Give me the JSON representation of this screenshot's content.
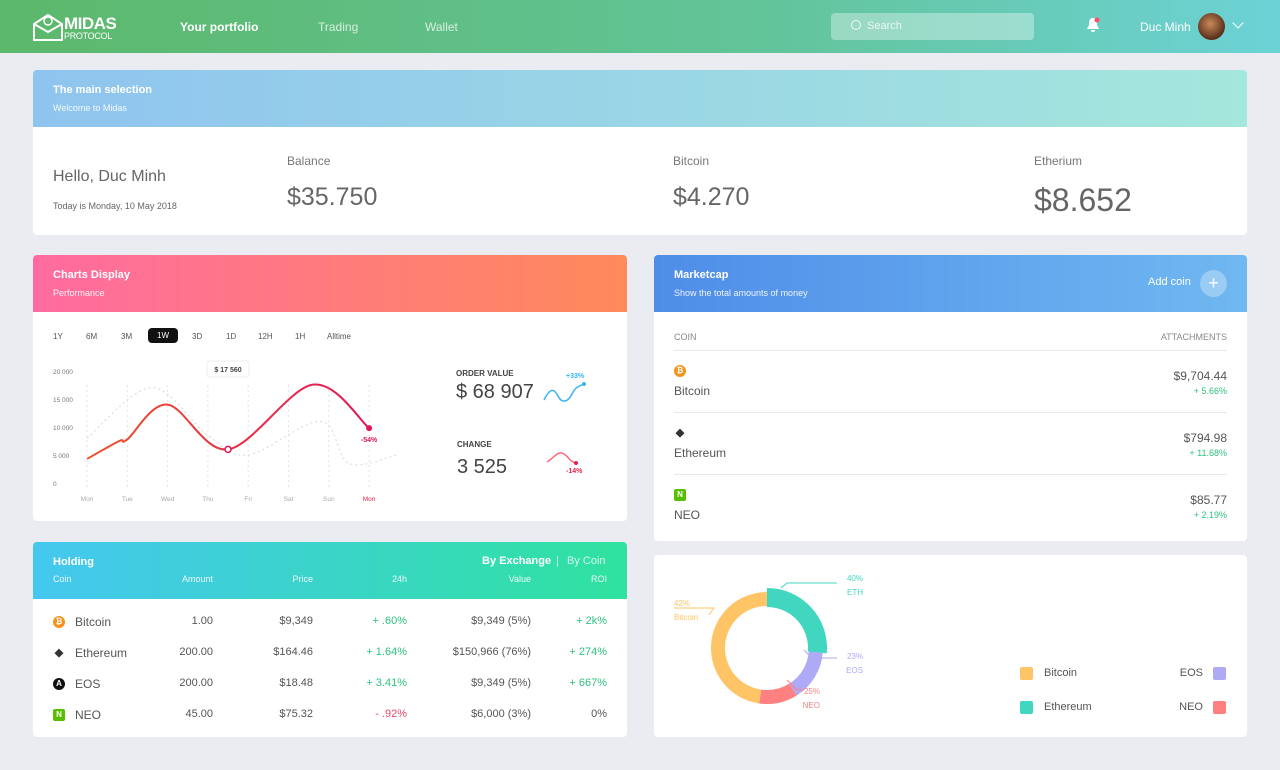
{
  "topbar": {
    "logo_line1": "MIDAS",
    "logo_line2": "PROTOCOL",
    "nav": [
      {
        "label": "Your portfolio",
        "active": true
      },
      {
        "label": "Trading"
      },
      {
        "label": "Wallet"
      }
    ],
    "search_placeholder": "Search",
    "user_name": "Duc Minh",
    "accent": "#5cb86a"
  },
  "summary": {
    "title": "The main selection",
    "subtitle": "Welcome to Midas",
    "greeting": "Hello, Duc Minh",
    "date": "Today is Monday, 10 May 2018",
    "balance_label": "Balance",
    "balance": "$35.750",
    "bitcoin_label": "Bitcoin",
    "bitcoin": "$4.270",
    "ethereum_label": "Etherium",
    "ethereum": "$8.652"
  },
  "charts": {
    "title": "Charts Display",
    "subtitle": "Performance",
    "tabs": [
      "1Y",
      "6M",
      "3M",
      "1W",
      "3D",
      "1D",
      "12H",
      "1H",
      "Alltime"
    ],
    "active_tab": "1W",
    "order_value_label": "ORDER VALUE",
    "order_value": "$ 68 907",
    "order_change": "+33%",
    "change_label": "CHANGE",
    "change": "3 525",
    "change_pct": "-14%"
  },
  "chart_data": {
    "type": "line",
    "x_labels": [
      "Mon",
      "Tue",
      "Wed",
      "Thu",
      "Fri",
      "Sat",
      "Sun",
      "Mon"
    ],
    "y_ticks": [
      "0",
      "5 000",
      "10 000",
      "15 000",
      "20 000"
    ],
    "ylim": [
      0,
      20000
    ],
    "series": [
      {
        "points": [
          [
            0,
            4300
          ],
          [
            0.8,
            7500
          ],
          [
            1,
            7800
          ],
          [
            2,
            14000
          ],
          [
            3.5,
            6000
          ],
          [
            5.6,
            17560
          ],
          [
            7,
            9800
          ]
        ],
        "color": "#e8234f"
      },
      {
        "points": [
          [
            0,
            8000
          ],
          [
            1.6,
            17000
          ],
          [
            3,
            8500
          ],
          [
            4,
            5000
          ],
          [
            5.8,
            11000
          ],
          [
            6.5,
            3500
          ],
          [
            7.7,
            5000
          ]
        ],
        "color": "#dddddd",
        "style": "dotted"
      }
    ],
    "tooltip": "$ 17 560",
    "end_label": "-54%"
  },
  "marketcap": {
    "title": "Marketcap",
    "subtitle": "Show the total amounts of money",
    "add_label": "Add coin",
    "col_coin": "COIN",
    "col_att": "ATTACHMENTS",
    "rows": [
      {
        "name": "Bitcoin",
        "icon": "bitcoin-icon",
        "value": "$9,704.44",
        "change": "+ 5.66%"
      },
      {
        "name": "Ethereum",
        "icon": "ethereum-icon",
        "value": "$794.98",
        "change": "+ 11.68%"
      },
      {
        "name": "NEO",
        "icon": "neo-icon",
        "value": "$85.77",
        "change": "+ 2.19%"
      }
    ]
  },
  "holding": {
    "title": "Holding",
    "by_exchange": "By Exchange",
    "sep": "|",
    "by_coin": "By Coin",
    "cols": [
      "Coin",
      "Amount",
      "Price",
      "24h",
      "Value",
      "ROI"
    ],
    "rows": [
      {
        "coin": "Bitcoin",
        "amount": "1.00",
        "price": "$9,349",
        "h24": "+ .60%",
        "value": "$9,349 (5%)",
        "roi": "+ 2k%"
      },
      {
        "coin": "Ethereum",
        "amount": "200.00",
        "price": "$164.46",
        "h24": "+ 1.64%",
        "value": "$150,966 (76%)",
        "roi": "+ 274%"
      },
      {
        "coin": "EOS",
        "amount": "200.00",
        "price": "$18.48",
        "h24": "+ 3.41%",
        "value": "$9,349 (5%)",
        "roi": "+ 667%"
      },
      {
        "coin": "NEO",
        "amount": "45.00",
        "price": "$75.32",
        "h24": "- .92%",
        "value": "$6,000 (3%)",
        "roi": "0%"
      }
    ]
  },
  "donut": {
    "slices": [
      {
        "name": "ETH",
        "legend": "Ethereum",
        "pct": "40%",
        "color": "#40d6c0"
      },
      {
        "name": "EOS",
        "legend": "EOS",
        "pct": "23%",
        "color": "#aeaaf6"
      },
      {
        "name": "NEO",
        "legend": "NEO",
        "pct": "25%",
        "color": "#ff8080"
      },
      {
        "name": "Bitcoin",
        "legend": "Bitcoin",
        "pct": "42%",
        "color": "#ffc466"
      }
    ]
  }
}
